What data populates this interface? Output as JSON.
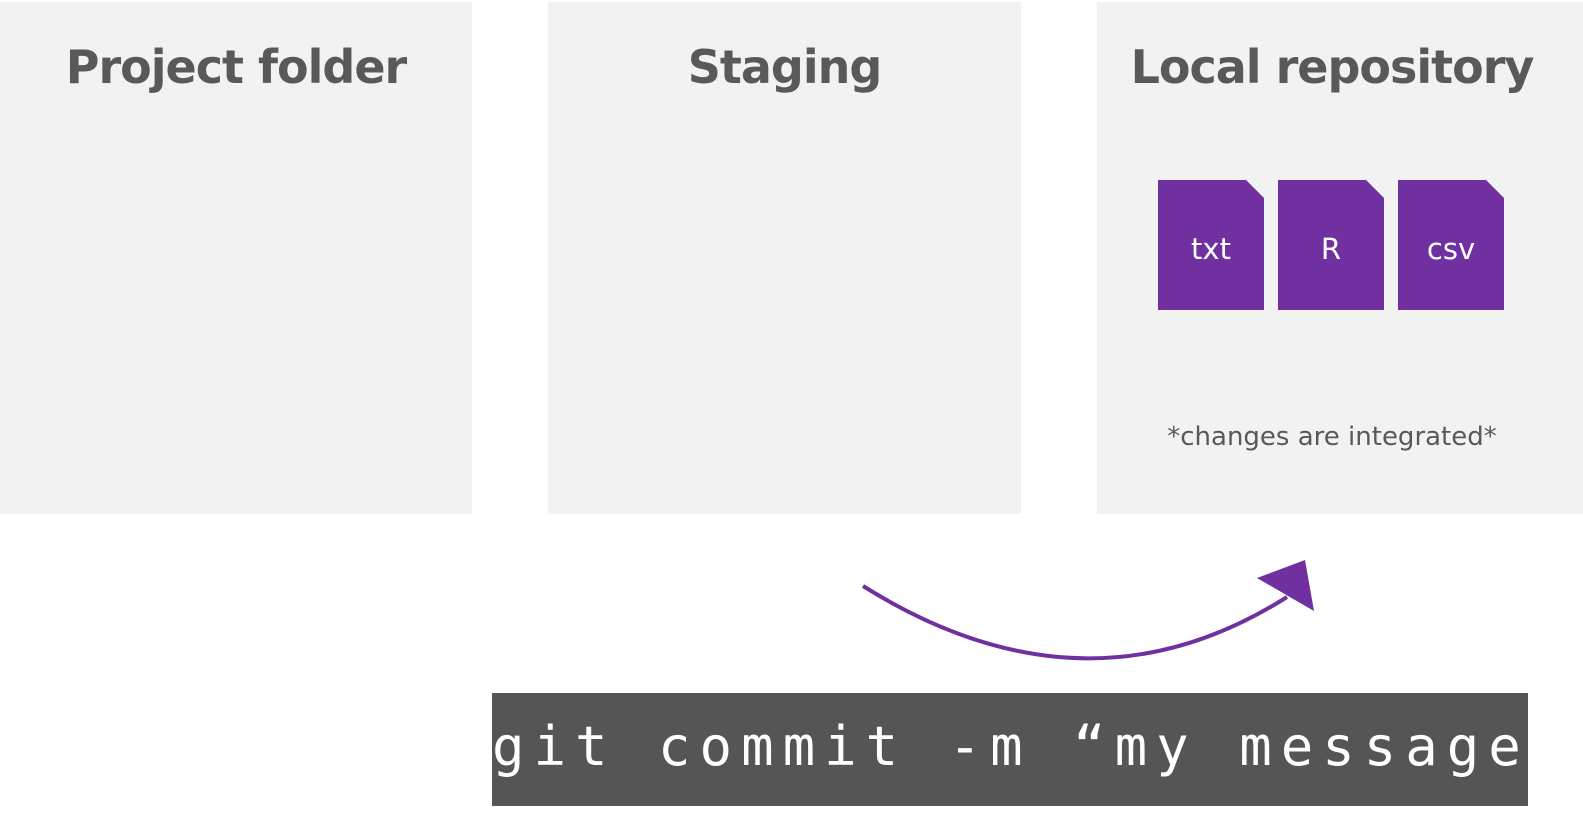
{
  "panels": {
    "project": {
      "title": "Project folder"
    },
    "staging": {
      "title": "Staging"
    },
    "repo": {
      "title": "Local repository",
      "files": [
        "txt",
        "R",
        "csv"
      ],
      "note": "*changes are integrated*"
    }
  },
  "command": "git commit -m “my message”",
  "colors": {
    "panel_bg": "#f2f2f2",
    "title_text": "#595959",
    "file_fill": "#7030a0",
    "arrow": "#7030a0",
    "command_bg": "#555555",
    "command_text": "#ffffff"
  },
  "icons": [
    "file-icon",
    "curved-arrow-icon"
  ]
}
